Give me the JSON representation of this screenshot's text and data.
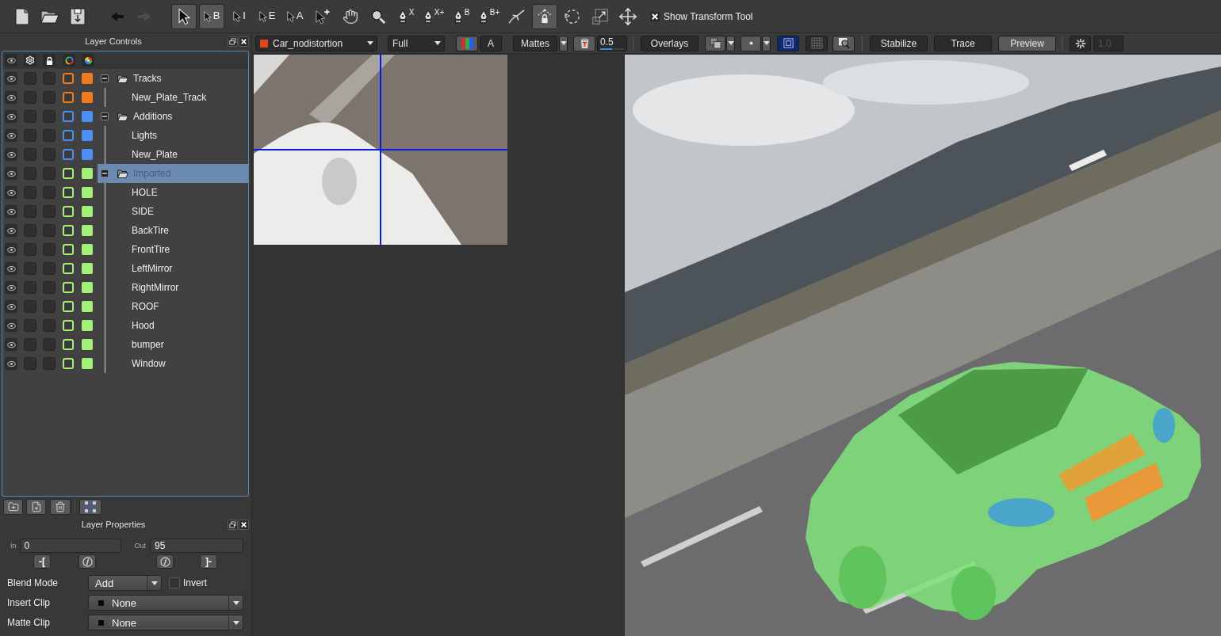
{
  "toolbar": {
    "nav_buttons": [
      {
        "kind": "back",
        "disabled": false
      },
      {
        "kind": "forward",
        "disabled": true
      }
    ],
    "tools": [
      {
        "kind": "pointer",
        "selected": true
      },
      {
        "kind": "pointer",
        "label": "B",
        "selected": true
      },
      {
        "kind": "pointer",
        "label": "I",
        "selected": false
      },
      {
        "kind": "pointer",
        "label": "E",
        "selected": false
      },
      {
        "kind": "pointer",
        "label": "A",
        "selected": false
      },
      {
        "kind": "pointer-add",
        "selected": false
      },
      {
        "kind": "hand",
        "selected": false
      },
      {
        "kind": "zoom",
        "selected": false
      },
      {
        "kind": "pen",
        "label": "X",
        "selected": false
      },
      {
        "kind": "pen",
        "label": "X+",
        "selected": false
      },
      {
        "kind": "pen",
        "label": "B",
        "selected": false
      },
      {
        "kind": "pen",
        "label": "B+",
        "selected": false
      },
      {
        "kind": "curve",
        "selected": false
      },
      {
        "kind": "lock-points",
        "selected": true
      },
      {
        "kind": "rotate",
        "selected": false
      },
      {
        "kind": "scale",
        "selected": false
      },
      {
        "kind": "move",
        "selected": false
      }
    ],
    "transform_toggle": {
      "label": "Show Transform Tool",
      "checked": true
    }
  },
  "layer_controls": {
    "title": "Layer Controls",
    "layers": [
      {
        "name": "Tracks",
        "color": "#ef7b1f",
        "visible": true,
        "gear_checked": false,
        "locked": false,
        "expanded": true,
        "selected": false,
        "children": [
          {
            "name": "New_Plate_Track",
            "color": "#ef7b1f",
            "visible": true,
            "gear_checked": false,
            "locked": false,
            "selected": false
          }
        ]
      },
      {
        "name": "Additions",
        "color": "#4d8ef5",
        "visible": true,
        "gear_checked": false,
        "locked": false,
        "expanded": true,
        "selected": false,
        "children": [
          {
            "name": "Lights",
            "color": "#4d8ef5",
            "visible": true,
            "gear_checked": false,
            "locked": false,
            "selected": false
          },
          {
            "name": "New_Plate",
            "color": "#4d8ef5",
            "visible": true,
            "gear_checked": false,
            "locked": false,
            "selected": false
          }
        ]
      },
      {
        "name": "Imported",
        "color": "#a3ef7a",
        "visible": true,
        "gear_checked": false,
        "locked": false,
        "expanded": true,
        "selected": true,
        "children": [
          {
            "name": "HOLE",
            "color": "#a3ef7a",
            "visible": true,
            "gear_checked": false,
            "locked": false,
            "selected": false
          },
          {
            "name": "SIDE",
            "color": "#a3ef7a",
            "visible": true,
            "gear_checked": false,
            "locked": false,
            "selected": false
          },
          {
            "name": "BackTire",
            "color": "#a3ef7a",
            "visible": true,
            "gear_checked": false,
            "locked": false,
            "selected": false
          },
          {
            "name": "FrontTire",
            "color": "#a3ef7a",
            "visible": true,
            "gear_checked": false,
            "locked": false,
            "selected": false
          },
          {
            "name": "LeftMirror",
            "color": "#a3ef7a",
            "visible": true,
            "gear_checked": false,
            "locked": false,
            "selected": false
          },
          {
            "name": "RightMirror",
            "color": "#a3ef7a",
            "visible": true,
            "gear_checked": false,
            "locked": false,
            "selected": false
          },
          {
            "name": "ROOF",
            "color": "#a3ef7a",
            "visible": true,
            "gear_checked": false,
            "locked": false,
            "selected": false
          },
          {
            "name": "Hood",
            "color": "#a3ef7a",
            "visible": true,
            "gear_checked": false,
            "locked": false,
            "selected": false
          },
          {
            "name": "bumper",
            "color": "#a3ef7a",
            "visible": true,
            "gear_checked": false,
            "locked": false,
            "selected": false
          },
          {
            "name": "Window",
            "color": "#a3ef7a",
            "visible": true,
            "gear_checked": false,
            "locked": false,
            "selected": false
          }
        ]
      }
    ]
  },
  "layer_properties": {
    "title": "Layer Properties",
    "in": {
      "label": "In",
      "value": "0"
    },
    "out": {
      "label": "Out",
      "value": "95"
    },
    "set_in_button": "-[",
    "set_out_button": "]-",
    "blend_mode": {
      "label": "Blend Mode",
      "value": "Add"
    },
    "invert": {
      "label": "Invert",
      "checked": false
    },
    "insert_clip": {
      "label": "Insert Clip",
      "value": "None"
    },
    "matte_clip": {
      "label": "Matte Clip",
      "value": "None"
    }
  },
  "viewer_toolbar": {
    "clip": "Car_nodistortion",
    "resolution": "Full",
    "channel_buttons": [
      {
        "kind": "rgb",
        "selected": true
      },
      {
        "kind": "alpha",
        "label": "A",
        "selected": false
      }
    ],
    "mattes_button": "Mattes",
    "matte_opacity": {
      "value": "0.5",
      "level": 0.5
    },
    "overlays_button": "Overlays",
    "view_toggles": [
      {
        "kind": "safe-frame",
        "selected": true
      },
      {
        "kind": "grid",
        "selected": false
      },
      {
        "kind": "magnifier",
        "selected": true
      }
    ],
    "mode_buttons": [
      {
        "label": "Stabilize",
        "selected": false
      },
      {
        "label": "Trace",
        "selected": false
      },
      {
        "label": "Preview",
        "selected": true
      }
    ],
    "scale_field": {
      "value": "1.0",
      "disabled": true
    }
  }
}
